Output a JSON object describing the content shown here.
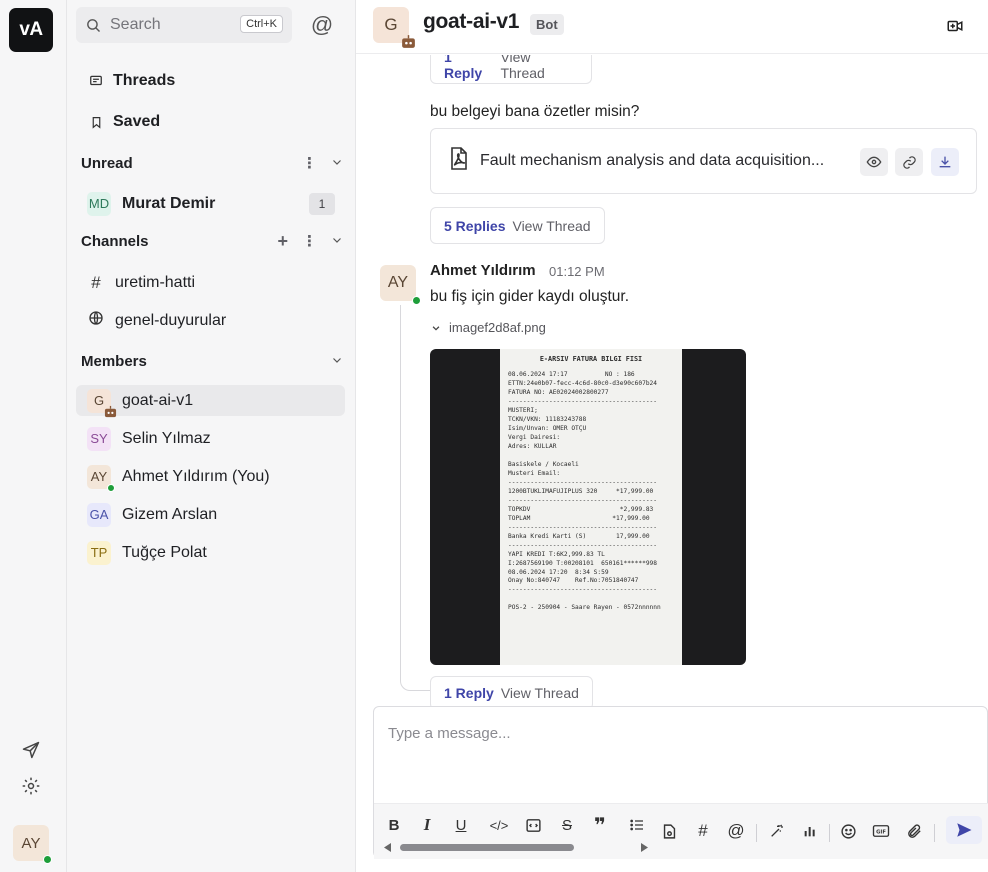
{
  "workspace": {
    "initials": "vA"
  },
  "rail": {
    "user_initials": "AY"
  },
  "sidebar": {
    "search": {
      "placeholder": "Search",
      "shortcut": "Ctrl+K"
    },
    "nav": [
      {
        "label": "Threads",
        "icon": "thread-icon"
      },
      {
        "label": "Saved",
        "icon": "bookmark-icon"
      }
    ],
    "unread": {
      "title": "Unread",
      "items": [
        {
          "initials": "MD",
          "name": "Murat Demir",
          "count": "1"
        }
      ]
    },
    "channels": {
      "title": "Channels",
      "items": [
        {
          "glyph": "#",
          "name": "uretim-hatti"
        },
        {
          "glyph": "globe",
          "name": "genel-duyurular"
        }
      ]
    },
    "members": {
      "title": "Members",
      "items": [
        {
          "initials": "G",
          "name": "goat-ai-v1",
          "bot": true
        },
        {
          "initials": "SY",
          "name": "Selin Yılmaz"
        },
        {
          "initials": "AY",
          "name": "Ahmet Yıldırım (You)"
        },
        {
          "initials": "GA",
          "name": "Gizem Arslan"
        },
        {
          "initials": "TP",
          "name": "Tuğçe Polat"
        }
      ]
    }
  },
  "header": {
    "avatar_initial": "G",
    "title": "goat-ai-v1",
    "badge": "Bot"
  },
  "messages": {
    "top_thread": {
      "count": "1 Reply",
      "view": "View Thread"
    },
    "request": "bu belgeyi bana özetler misin?",
    "file": {
      "name": "Fault mechanism analysis and data acquisition..."
    },
    "file_thread": {
      "count": "5 Replies",
      "view": "View Thread"
    },
    "second": {
      "avatar": "AY",
      "author": "Ahmet Yıldırım",
      "time": "01:12 PM",
      "text": "bu fiş için gider kaydı oluştur.",
      "attachment": "imagef2d8af.png",
      "thread": {
        "count": "1 Reply",
        "view": "View Thread"
      }
    }
  },
  "receipt_text": {
    "title": "E-ARSIV FATURA BILGI FISI",
    "lines": [
      "08.06.2024 17:17          NO : 186",
      "ETTN:24e0b07-fecc-4c6d-80c0-d3e90c607b24",
      "FATURA NO: AE02024002800277",
      "----------------------------------------",
      "MUSTERI;",
      "TCKN/VKN: 11183243788",
      "Isim/Unvan: OMER OTÇU",
      "Vergi Dairesi:",
      "Adres: KULLAR",
      "",
      "Basiskele / Kocaeli",
      "Musteri Email:",
      "----------------------------------------",
      "1200BTUKLIMAFUJIPLUS 320     *17,999.00",
      "----------------------------------------",
      "TOPKDV                        *2,999.83",
      "TOPLAM                      *17,999.00",
      "----------------------------------------",
      "Banka Kredi Karti (S)        17,999.00",
      "----------------------------------------",
      "YAPI KREDI T:6K2,999.83 TL",
      "I:2687569190 T:00208101  650161******998",
      "08.06.2024 17:20  8:34 S:59",
      "Onay No:840747    Ref.No:7051840747",
      "----------------------------------------",
      "",
      "POS-2 - 250904 - Saare Rayen - 0572nnnnnn"
    ]
  },
  "composer": {
    "placeholder": "Type a message..."
  }
}
